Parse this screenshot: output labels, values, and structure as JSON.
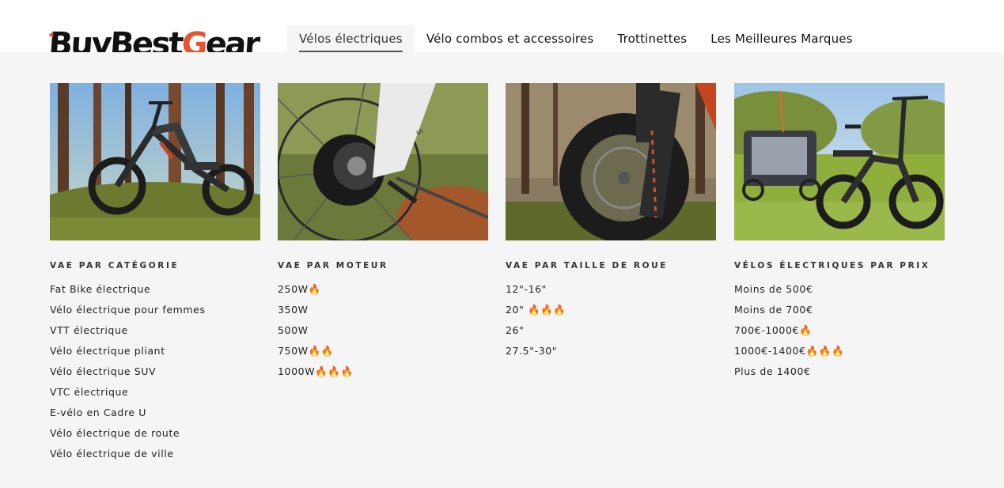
{
  "brand": {
    "logo_part1": "BuyBest",
    "logo_part2": "G",
    "logo_part3": "ear",
    "accent_color": "#e8522d"
  },
  "nav": {
    "items": [
      {
        "label": "Vélos électriques"
      },
      {
        "label": "Vélo combos et accessoires"
      },
      {
        "label": "Trottinettes"
      },
      {
        "label": "Les Meilleures Marques"
      }
    ]
  },
  "menu": {
    "columns": [
      {
        "title": "VAE PAR CATÉGORIE",
        "items": [
          "Fat Bike électrique",
          "Vélo électrique pour femmes",
          "VTT électrique",
          "Vélo électrique pliant",
          "Vélo électrique SUV",
          "VTC électrique",
          "E-vélo en Cadre U",
          "Vélo électrique de route",
          "Vélo électrique de ville"
        ]
      },
      {
        "title": "VAE PAR MOTEUR",
        "items": [
          "250W🔥",
          "350W",
          "500W",
          "750W🔥🔥",
          "1000W🔥🔥🔥"
        ]
      },
      {
        "title": "VAE PAR TAILLE DE ROUE",
        "items": [
          "12\"-16\"",
          "20\" 🔥🔥🔥",
          "26\"",
          "27.5\"-30\""
        ]
      },
      {
        "title": "VÉLOS ÉLECTRIQUES PAR PRIX",
        "items": [
          "Moins de 500€",
          "Moins de 700€",
          "700€-1000€🔥",
          "1000€-1400€🔥🔥🔥",
          "Plus de 1400€"
        ]
      }
    ]
  }
}
